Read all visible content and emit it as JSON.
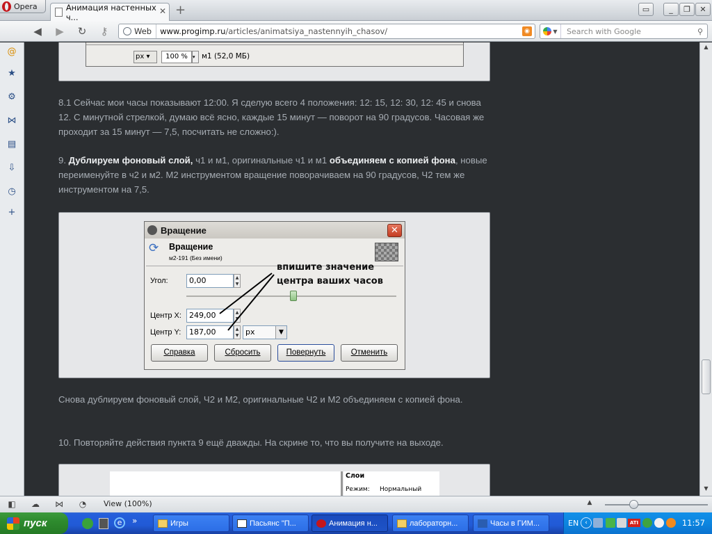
{
  "browser": {
    "menu_label": "Opera",
    "tab_title": "Анимация настенных ч...",
    "address_mode": "Web",
    "url_host": "www.progimp.ru",
    "url_path": "/articles/animatsiya_nastennyih_chasov/",
    "search_placeholder": "Search with Google"
  },
  "gimp_fragment": {
    "unit": "px",
    "zoom": "100 %",
    "layer_info": "м1 (52,0 МБ)"
  },
  "article": {
    "p1": "8.1 Сейчас мои часы показывают 12:00. Я сделую всего 4 положения: 12: 15, 12: 30, 12: 45 и снова 12. С минутной стрелкой, думаю всё ясно, каждые 15 минут — поворот на 90 градусов. Часовая же проходит за 15 минут — 7,5, посчитать не сложно:).",
    "p2_num": "9. ",
    "p2_b1": "Дублируем фоновый слой,",
    "p2_t1": " ч1 и м1, оригинальные ч1 и м1 ",
    "p2_b2": "объединяем с копией фона",
    "p2_t2": ", новые переименуйте в ч2 и м2. М2 инструментом вращение поворачиваем на 90 градусов, Ч2 тем же инструментом на 7,5.",
    "p3": "Снова дублируем фоновый слой, Ч2 и М2, оригинальные Ч2 и М2 объединяем с копией фона.",
    "p4": "10. Повторяйте действия пункта 9 ещё дважды. На скрине то, что вы получите на выходе."
  },
  "dialog": {
    "title": "Вращение",
    "heading": "Вращение",
    "subheading": "м2-191 (Без имени)",
    "annotation_line1": "впишите значение",
    "annotation_line2": "центра ваших часов",
    "angle_label": "Угол:",
    "angle_value": "0,00",
    "center_x_label": "Центр X:",
    "center_x_value": "249,00",
    "center_y_label": "Центр Y:",
    "center_y_value": "187,00",
    "unit_value": "px",
    "btn_help": "Справка",
    "btn_reset": "Сбросить",
    "btn_rotate": "Повернуть",
    "btn_cancel": "Отменить"
  },
  "bottom_image": {
    "panel_title": "Слои",
    "mode_label": "Режим:",
    "mode_value": "Нормальный"
  },
  "status": {
    "view": "View (100%)"
  },
  "taskbar": {
    "start": "пуск",
    "items": [
      "Игры",
      "Пасьянс \"П...",
      "Анимация н...",
      "лабораторн...",
      "Часы в ГИМ..."
    ],
    "lang": "EN",
    "clock": "11:57"
  }
}
